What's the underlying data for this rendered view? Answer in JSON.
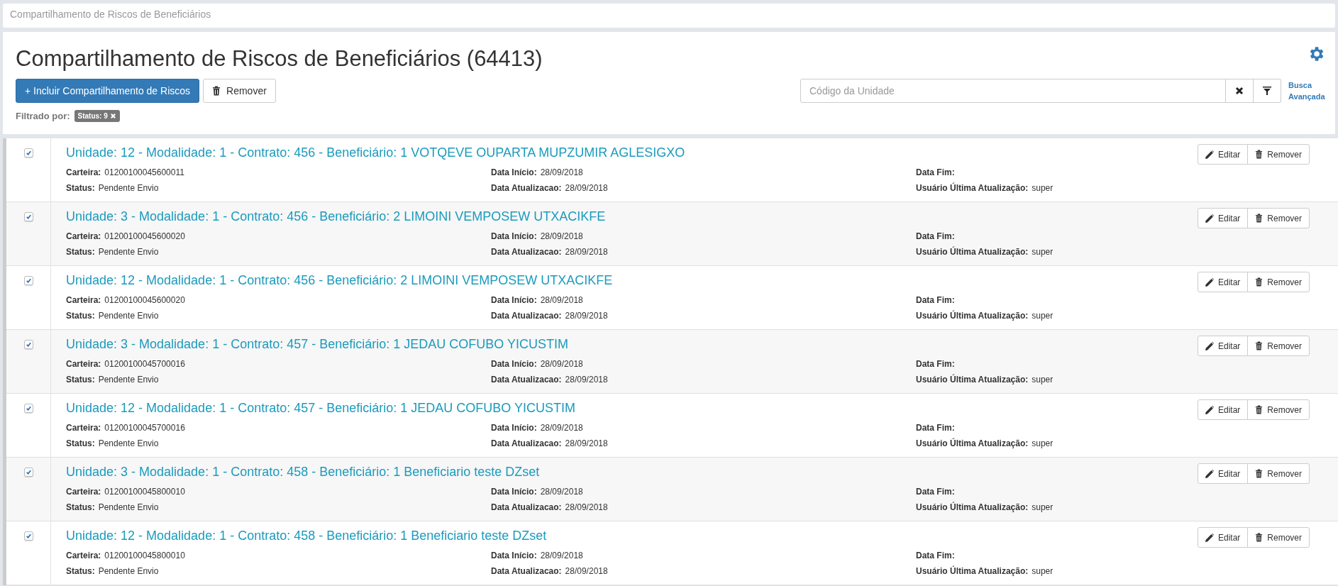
{
  "breadcrumb": "Compartilhamento de Riscos de Beneficiários",
  "header": {
    "title": "Compartilhamento de Riscos de Beneficiários (64413)",
    "add_button": "+ Incluir Compartilhamento de Riscos",
    "remove_button": "Remover",
    "search": {
      "placeholder": "Código da Unidade"
    },
    "advanced_search": "Busca Avançada",
    "filter_label": "Filtrado por:",
    "filters": [
      "Status: 9"
    ]
  },
  "rows": [
    {
      "checked": true,
      "title": "Unidade: 12 - Modalidade: 1 - Contrato: 456 - Beneficiário: 1 VOTQEVE OUPARTA MUPZUMIR AGLESIGXO",
      "fields": [
        {
          "label": "Carteira:",
          "value": "01200100045600011"
        },
        {
          "label": "Data Início:",
          "value": "28/09/2018"
        },
        {
          "label": "Data Fim:"
        },
        {
          "label": "Status:",
          "value": "Pendente Envio"
        },
        {
          "label": "Data Atualizacao:",
          "value": "28/09/2018"
        },
        {
          "label": "Usuário Última Atualização:",
          "value": "super"
        }
      ],
      "buttons": [
        "Editar",
        "Remover"
      ]
    },
    {
      "checked": true,
      "title": "Unidade: 3 - Modalidade: 1 - Contrato: 456 - Beneficiário: 2 LIMOINI VEMPOSEW UTXACIKFE",
      "fields": [
        {
          "label": "Carteira:",
          "value": "01200100045600020"
        },
        {
          "label": "Data Início:",
          "value": "28/09/2018"
        },
        {
          "label": "Data Fim:"
        },
        {
          "label": "Status:",
          "value": "Pendente Envio"
        },
        {
          "label": "Data Atualizacao:",
          "value": "28/09/2018"
        },
        {
          "label": "Usuário Última Atualização:",
          "value": "super"
        }
      ],
      "buttons": [
        "Editar",
        "Remover"
      ]
    },
    {
      "checked": true,
      "title": "Unidade: 12 - Modalidade: 1 - Contrato: 456 - Beneficiário: 2 LIMOINI VEMPOSEW UTXACIKFE",
      "fields": [
        {
          "label": "Carteira:",
          "value": "01200100045600020"
        },
        {
          "label": "Data Início:",
          "value": "28/09/2018"
        },
        {
          "label": "Data Fim:"
        },
        {
          "label": "Status:",
          "value": "Pendente Envio"
        },
        {
          "label": "Data Atualizacao:",
          "value": "28/09/2018"
        },
        {
          "label": "Usuário Última Atualização:",
          "value": "super"
        }
      ],
      "buttons": [
        "Editar",
        "Remover"
      ]
    },
    {
      "checked": true,
      "title": "Unidade: 3 - Modalidade: 1 - Contrato: 457 - Beneficiário: 1 JEDAU COFUBO YICUSTIM",
      "fields": [
        {
          "label": "Carteira:",
          "value": "01200100045700016"
        },
        {
          "label": "Data Início:",
          "value": "28/09/2018"
        },
        {
          "label": "Data Fim:"
        },
        {
          "label": "Status:",
          "value": "Pendente Envio"
        },
        {
          "label": "Data Atualizacao:",
          "value": "28/09/2018"
        },
        {
          "label": "Usuário Última Atualização:",
          "value": "super"
        }
      ],
      "buttons": [
        "Editar",
        "Remover"
      ]
    },
    {
      "checked": true,
      "title": "Unidade: 12 - Modalidade: 1 - Contrato: 457 - Beneficiário: 1 JEDAU COFUBO YICUSTIM",
      "fields": [
        {
          "label": "Carteira:",
          "value": "01200100045700016"
        },
        {
          "label": "Data Início:",
          "value": "28/09/2018"
        },
        {
          "label": "Data Fim:"
        },
        {
          "label": "Status:",
          "value": "Pendente Envio"
        },
        {
          "label": "Data Atualizacao:",
          "value": "28/09/2018"
        },
        {
          "label": "Usuário Última Atualização:",
          "value": "super"
        }
      ],
      "buttons": [
        "Editar",
        "Remover"
      ]
    },
    {
      "checked": true,
      "title": "Unidade: 3 - Modalidade: 1 - Contrato: 458 - Beneficiário: 1 Beneficiario teste DZset",
      "fields": [
        {
          "label": "Carteira:",
          "value": "01200100045800010"
        },
        {
          "label": "Data Início:",
          "value": "28/09/2018"
        },
        {
          "label": "Data Fim:"
        },
        {
          "label": "Status:",
          "value": "Pendente Envio"
        },
        {
          "label": "Data Atualizacao:",
          "value": "28/09/2018"
        },
        {
          "label": "Usuário Última Atualização:",
          "value": "super"
        }
      ],
      "buttons": [
        "Editar",
        "Remover"
      ]
    },
    {
      "checked": true,
      "title": "Unidade: 12 - Modalidade: 1 - Contrato: 458 - Beneficiário: 1 Beneficiario teste DZset",
      "fields": [
        {
          "label": "Carteira:",
          "value": "01200100045800010"
        },
        {
          "label": "Data Início:",
          "value": "28/09/2018"
        },
        {
          "label": "Data Fim:"
        },
        {
          "label": "Status:",
          "value": "Pendente Envio"
        },
        {
          "label": "Data Atualizacao:",
          "value": "28/09/2018"
        },
        {
          "label": "Usuário Última Atualização:",
          "value": "super"
        }
      ],
      "buttons": [
        "Editar",
        "Remover"
      ]
    }
  ]
}
